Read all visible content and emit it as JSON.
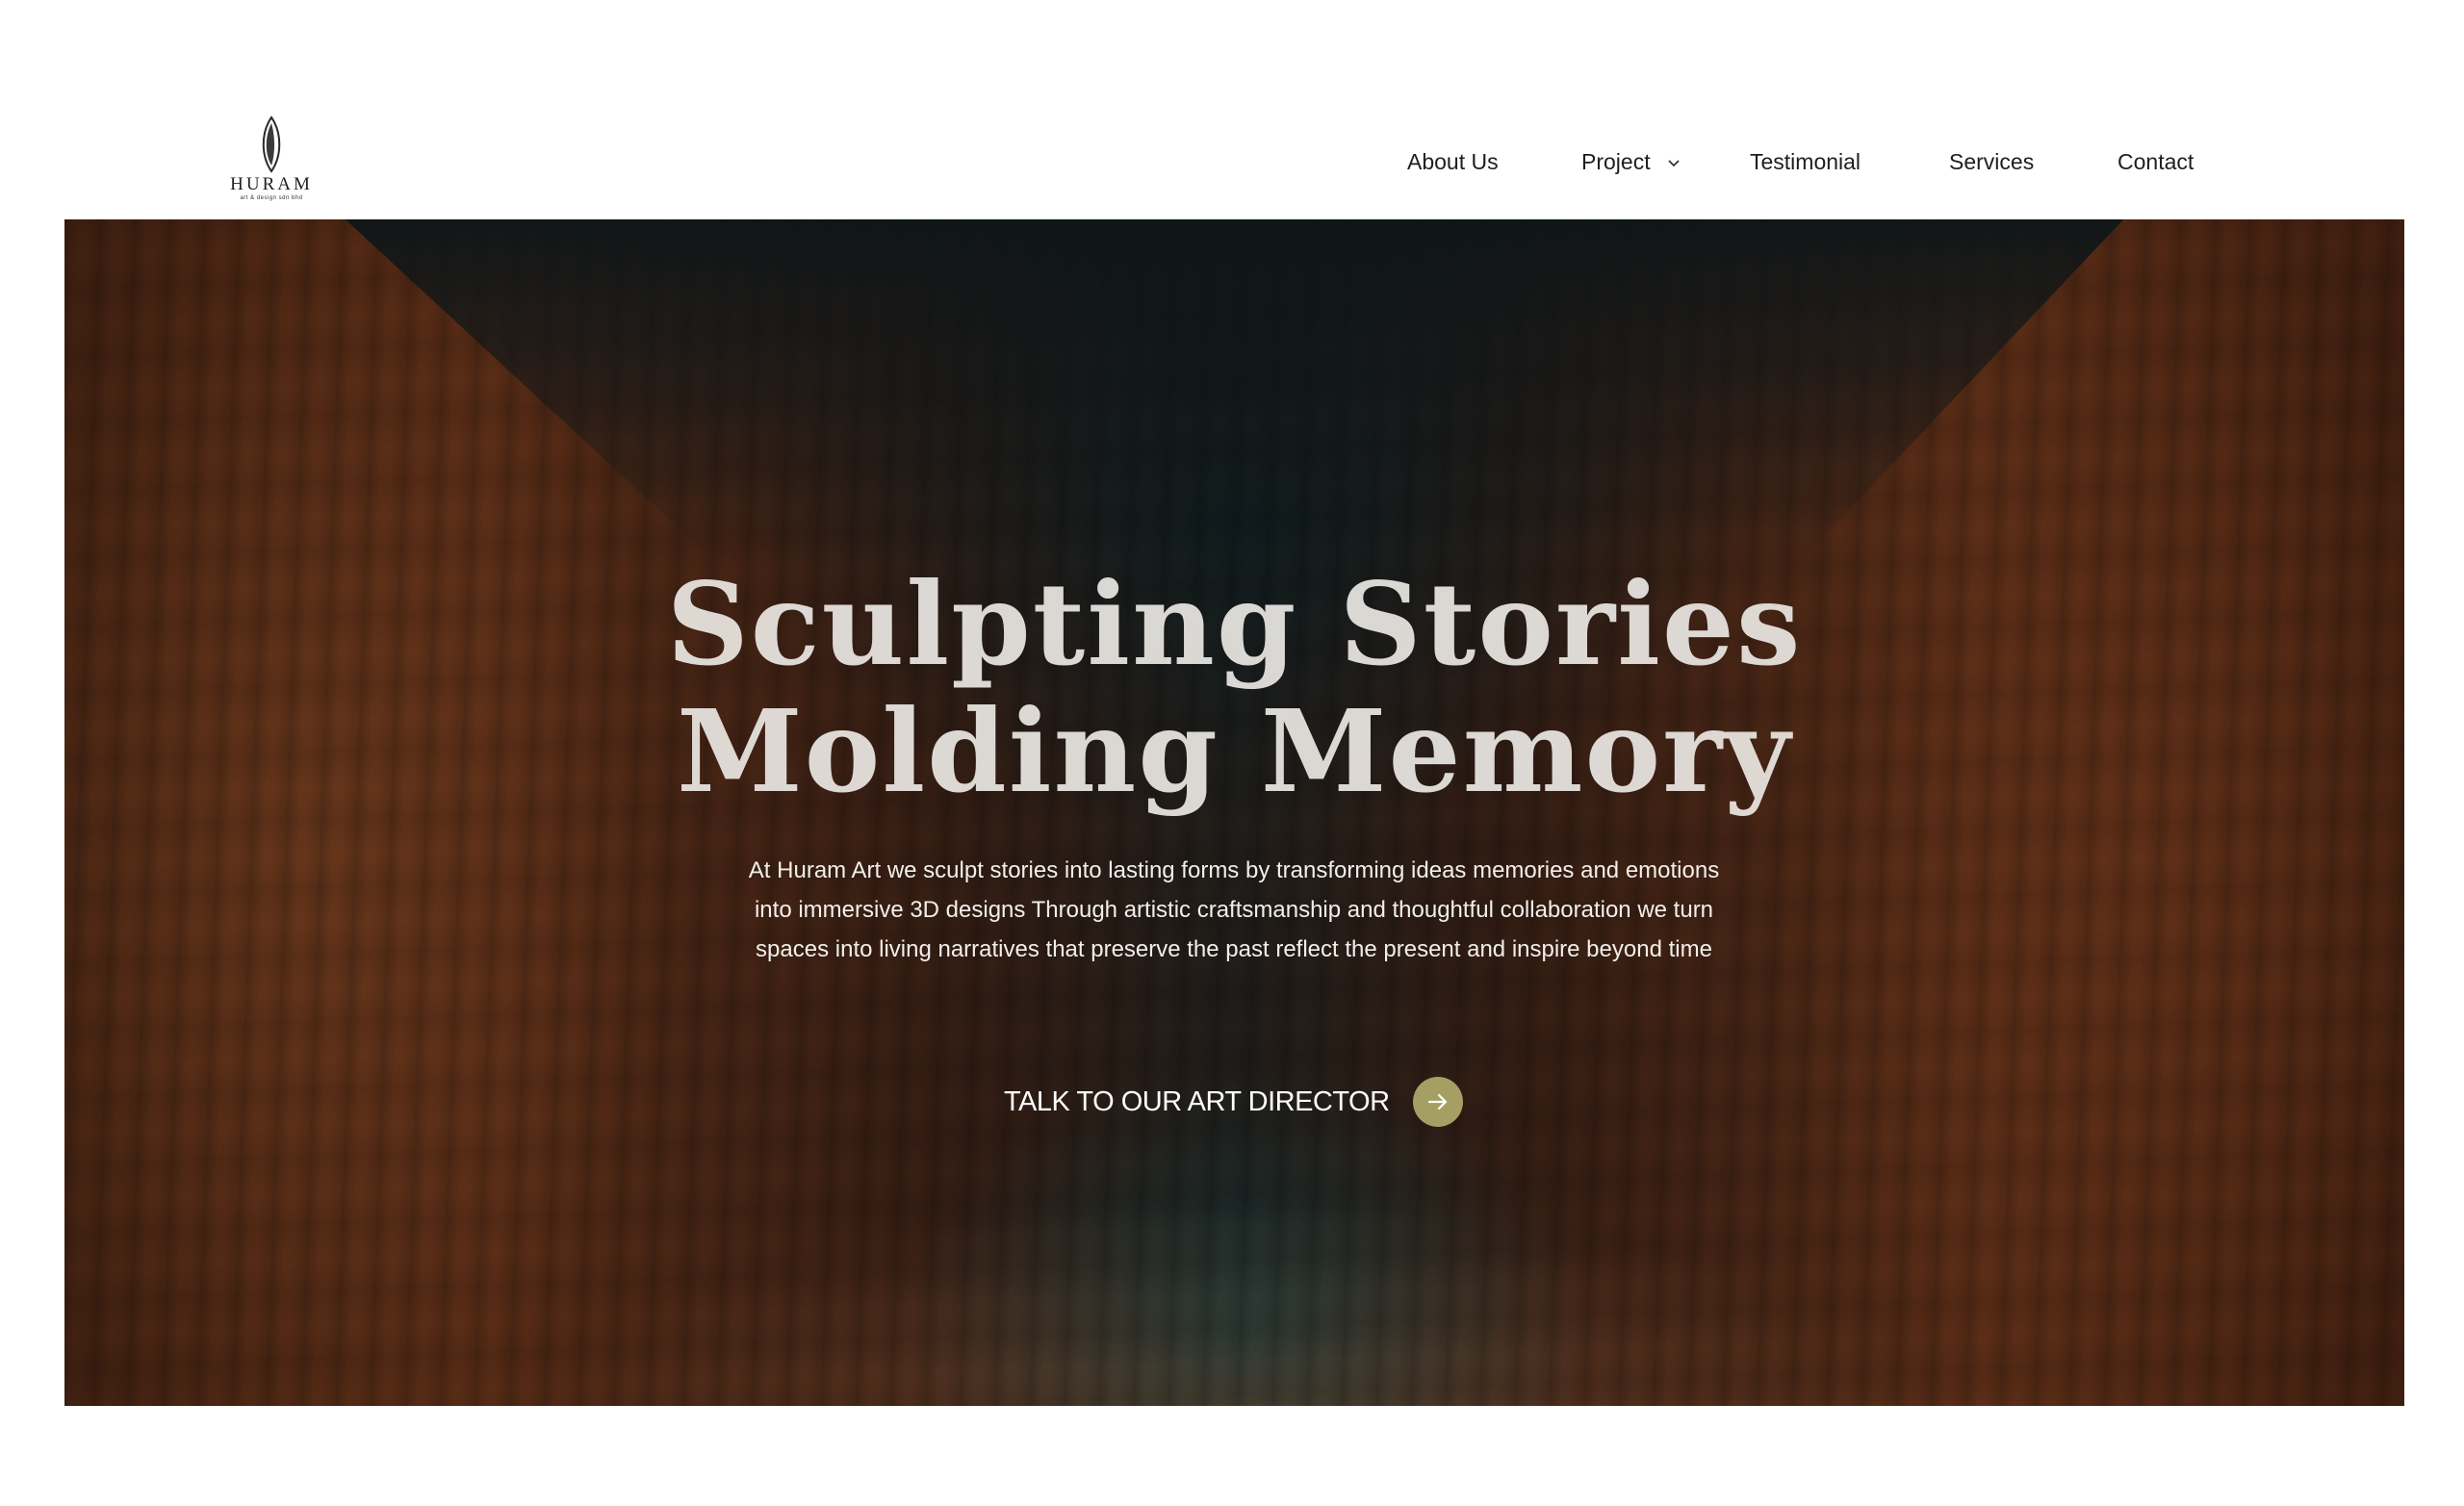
{
  "brand": {
    "name": "HURAM",
    "tagline": "art & design sdn bhd",
    "logo_icon": "leaf-drop-icon"
  },
  "nav": {
    "items": [
      {
        "label": "About Us"
      },
      {
        "label": "Project",
        "icon": "chevron-down-icon"
      },
      {
        "label": "Testimonial"
      },
      {
        "label": "Services"
      },
      {
        "label": "Contact"
      }
    ]
  },
  "hero": {
    "title_line1": "Sculpting Stories",
    "title_line2": "Molding Memory",
    "description": "At Huram Art we sculpt stories into lasting forms by transforming ideas memories and emotions into immersive 3D designs Through artistic craftsmanship and thoughtful collaboration we turn spaces into living narratives that preserve the past reflect the present and inspire beyond time",
    "cta_label": "TALK TO OUR ART DIRECTOR",
    "cta_icon": "arrow-right-icon",
    "background": "cave-sculpture-photo"
  },
  "colors": {
    "accent": "#a69f63",
    "nav_text": "#1e1e1e",
    "hero_text": "#f2efea"
  }
}
